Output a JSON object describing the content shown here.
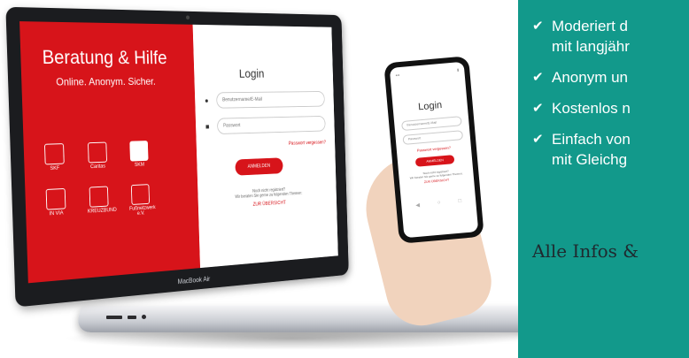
{
  "laptop": {
    "brand_left": {
      "title": "Beratung & Hilfe",
      "tagline": "Online. Anonym. Sicher."
    },
    "logos": [
      "SKF",
      "Caritas",
      "SKM",
      "IN VIA",
      "KREUZBUND",
      "Fußnetzwerk e.V."
    ],
    "login": {
      "title": "Login",
      "user_placeholder": "Benutzername/E-Mail",
      "password_placeholder": "Passwort",
      "forgot": "Passwort vergessen?",
      "button": "ANMELDEN",
      "not_registered": "Noch nicht registriert?",
      "hint": "Wir beraten Sie gerne zu folgenden Themen:",
      "overview": "ZUR ÜBERSICHT"
    },
    "brand": "MacBook Air"
  },
  "phone": {
    "login": {
      "title": "Login",
      "user_placeholder": "Benutzername/E-Mail",
      "password_placeholder": "Passwort",
      "forgot": "Passwort vergessen?",
      "button": "ANMELDEN",
      "not_registered": "Noch nicht registriert?",
      "hint": "Wir beraten Sie gerne zu folgenden Themen:",
      "overview": "ZUR ÜBERSICHT"
    }
  },
  "features": [
    "Moderiert d",
    "mit langjähr",
    "Anonym un",
    "Kostenlos n",
    "Einfach von",
    "mit Gleichg"
  ],
  "more": "Alle Infos &",
  "colors": {
    "red": "#d7141a",
    "green": "#12998b"
  }
}
